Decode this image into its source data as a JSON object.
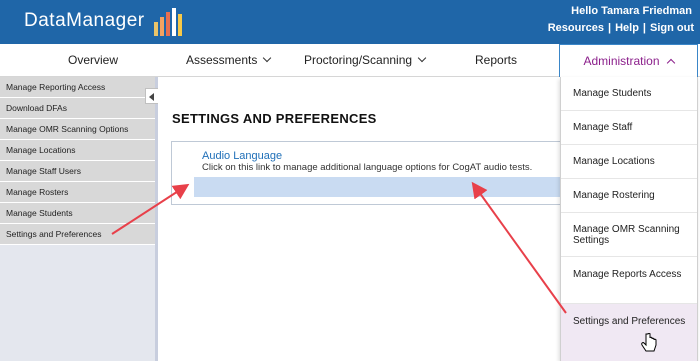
{
  "header": {
    "logo_text": "DataManager",
    "greeting": "Hello Tamara Friedman",
    "links": [
      "Resources",
      "Help",
      "Sign out"
    ],
    "separator": "|",
    "bg_color": "#1f66a8"
  },
  "nav": {
    "items": [
      {
        "label": "Overview",
        "has_chevron": false
      },
      {
        "label": "Assessments",
        "has_chevron": true
      },
      {
        "label": "Proctoring/Scanning",
        "has_chevron": true
      },
      {
        "label": "Reports",
        "has_chevron": false
      }
    ],
    "active": {
      "label": "Administration",
      "color": "#8b1f8b"
    }
  },
  "sidebar": {
    "items": [
      {
        "label": "Manage Reporting Access"
      },
      {
        "label": "Download DFAs"
      },
      {
        "label": "Manage OMR Scanning Options"
      },
      {
        "label": "Manage Locations"
      },
      {
        "label": "Manage Staff Users"
      },
      {
        "label": "Manage Rosters"
      },
      {
        "label": "Manage Students"
      },
      {
        "label": "Settings and Preferences"
      }
    ],
    "collapse_icon": "chevron-left-icon"
  },
  "main": {
    "title": "SETTINGS AND PREFERENCES",
    "link_title": "Audio Language",
    "link_desc": "Click on this link to manage additional language options for CogAT audio tests."
  },
  "dropdown": {
    "items": [
      {
        "label": "Manage Students"
      },
      {
        "label": "Manage Staff"
      },
      {
        "label": "Manage Locations"
      },
      {
        "label": "Manage Rostering"
      },
      {
        "label": "Manage OMR Scanning Settings"
      },
      {
        "label": "Manage Reports Access"
      },
      {
        "label": "Settings and Preferences"
      }
    ],
    "active_bg": "#f0e8f3"
  },
  "annotation": {
    "arrow_color": "#e8404a"
  }
}
